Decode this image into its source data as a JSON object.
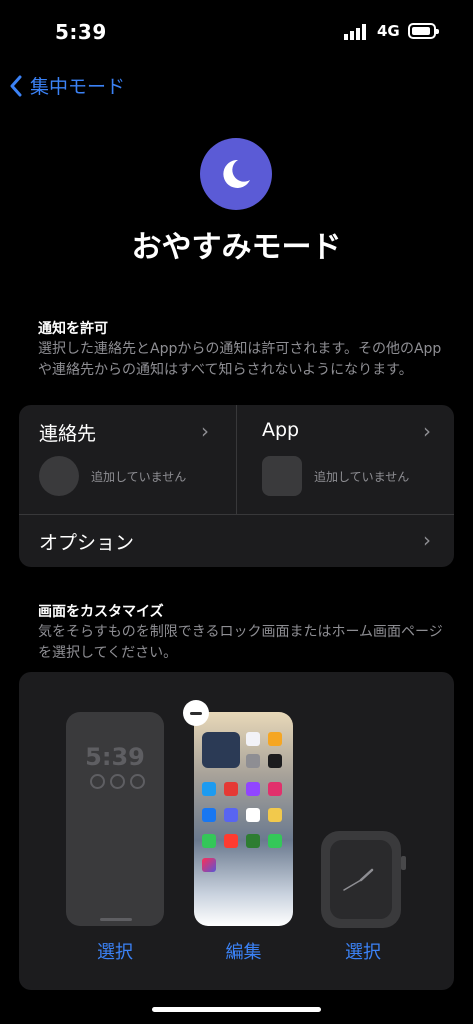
{
  "status": {
    "time": "5:39",
    "network": "4G"
  },
  "nav": {
    "back_label": "集中モード"
  },
  "mode": {
    "title": "おやすみモード",
    "icon": "moon-icon",
    "color": "#5b5bd6"
  },
  "notifications": {
    "heading": "通知を許可",
    "description": "選択した連絡先とAppからの通知は許可されます。その他のAppや連絡先からの通知はすべて知らされないようになります。",
    "contacts_label": "連絡先",
    "apps_label": "App",
    "contacts_empty": "追加していません",
    "apps_empty": "追加していません",
    "options_label": "オプション"
  },
  "customize": {
    "heading": "画面をカスタマイズ",
    "description": "気をそらすものを制限できるロック画面またはホーム画面ページを選択してください。",
    "lock_preview_time": "5:39",
    "lock_action": "選択",
    "home_action": "編集",
    "watch_action": "選択"
  },
  "colors": {
    "accent": "#3b82f6",
    "card": "#1c1c1e"
  }
}
